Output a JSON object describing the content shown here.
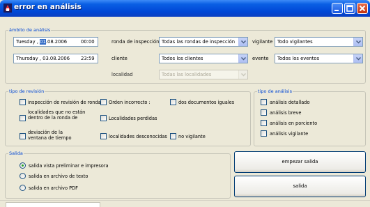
{
  "window": {
    "title": "error en análisis"
  },
  "ambito": {
    "group_title": "ámbito de análisis",
    "date_from": {
      "day": "Tuesday",
      "sep": ",",
      "selected_part": "01",
      "rest": ".08.2006",
      "time": "00:00"
    },
    "date_to": {
      "day": "Thursday",
      "sep": ",",
      "value": "03.08.2006",
      "time": "23:59"
    },
    "ronda_label": "ronda de inspección",
    "ronda_value": "Todas las rondas de inspección",
    "vigilante_label": "vigilante",
    "vigilante_value": "Todo vigilantes",
    "cliente_label": "cliente",
    "cliente_value": "Todos los clientes",
    "evente_label": "evente",
    "evente_value": "Todos los eventos",
    "localidad_label": "localidad",
    "localidad_value": "Todas las localidades"
  },
  "revision": {
    "group_title": "tipo de revisión",
    "items": [
      "inspección de revisión de ronda",
      "Orden incorrecto :",
      "dos documentos iguales",
      "localidades que no están dentro de la ronda de",
      "Localidades perdidas",
      "deviación de la ventana de tiempo",
      "localidades desconocidas",
      "no vigilante"
    ]
  },
  "analisis": {
    "group_title": "tipo de análisis",
    "items": [
      "análisis detallado",
      "análisis breve",
      "análisis en porciento",
      "análisis vigilante"
    ]
  },
  "salida": {
    "group_title": "Salida",
    "options": [
      "salida vista preliminar e impresora",
      "salida en archivo de texto",
      "salida en archivo PDF"
    ],
    "selected_index": 0
  },
  "buttons": {
    "start": "empezar salida",
    "exit": "salida"
  },
  "colors": {
    "titlebar": "#0047d6",
    "group_title": "#0046d5",
    "face": "#ece9d8",
    "radio_dot": "#21a121",
    "close": "#c2300c"
  },
  "icons": [
    "app-icon",
    "minimize-icon",
    "maximize-icon",
    "close-icon",
    "chevron-down-icon",
    "spin-up-icon",
    "spin-down-icon"
  ]
}
